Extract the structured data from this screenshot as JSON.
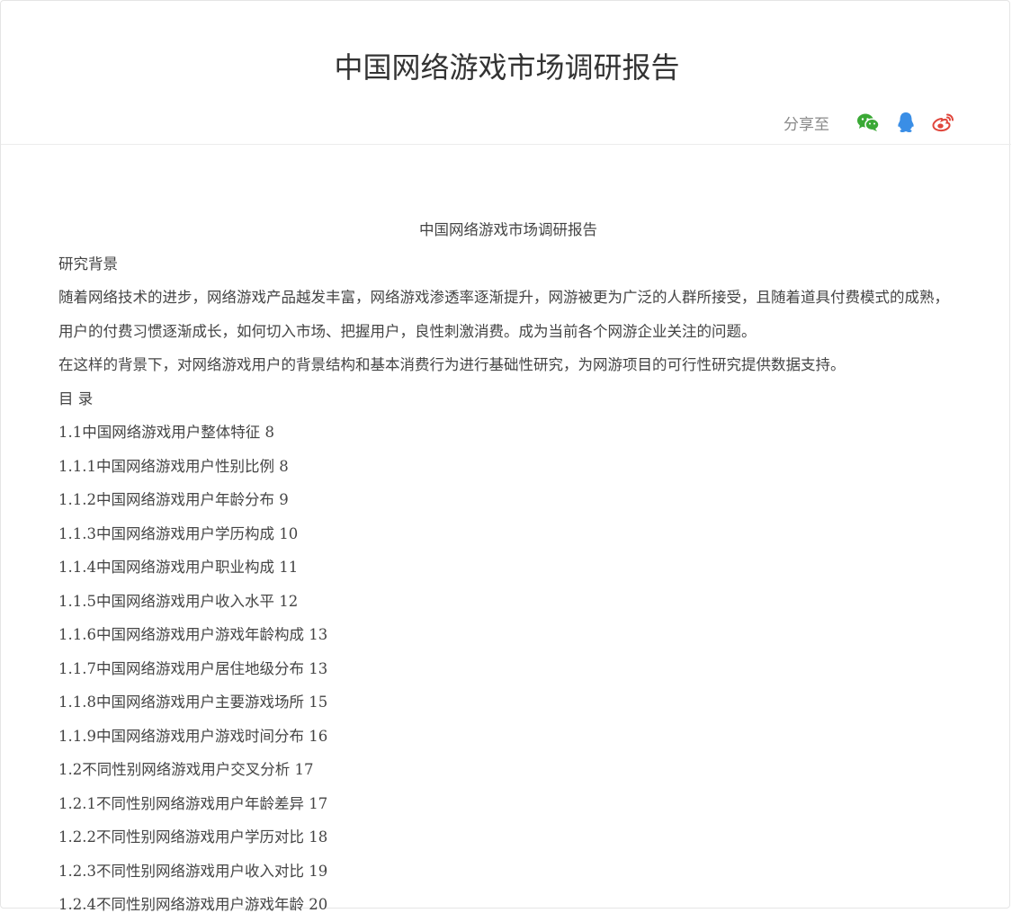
{
  "header": {
    "title": "中国网络游戏市场调研报告",
    "share_label": "分享至",
    "share_icons": [
      "wechat-icon",
      "qq-icon",
      "weibo-icon"
    ],
    "colors": {
      "wechat": "#3aa935",
      "qq": "#3a8ee6",
      "weibo": "#e0463c"
    }
  },
  "article": {
    "doc_title": "中国网络游戏市场调研报告",
    "background_heading": "研究背景",
    "paragraphs": [
      "随着网络技术的进步，网络游戏产品越发丰富，网络游戏渗透率逐渐提升，网游被更为广泛的人群所接受，且随着道具付费模式的成熟，用户的付费习惯逐渐成长，如何切入市场、把握用户，良性刺激消费。成为当前各个网游企业关注的问题。",
      "在这样的背景下，对网络游戏用户的背景结构和基本消费行为进行基础性研究，为网游项目的可行性研究提供数据支持。"
    ],
    "toc_heading": "目 录",
    "toc": [
      {
        "num": "1.1",
        "title": "中国网络游戏用户整体特征",
        "page": "8"
      },
      {
        "num": "1.1.1",
        "title": "中国网络游戏用户性别比例",
        "page": "8"
      },
      {
        "num": "1.1.2",
        "title": "中国网络游戏用户年龄分布",
        "page": "9"
      },
      {
        "num": "1.1.3",
        "title": "中国网络游戏用户学历构成",
        "page": "10"
      },
      {
        "num": "1.1.4",
        "title": "中国网络游戏用户职业构成",
        "page": "11"
      },
      {
        "num": "1.1.5",
        "title": "中国网络游戏用户收入水平",
        "page": "12"
      },
      {
        "num": "1.1.6",
        "title": "中国网络游戏用户游戏年龄构成",
        "page": "13"
      },
      {
        "num": "1.1.7",
        "title": "中国网络游戏用户居住地级分布",
        "page": "13"
      },
      {
        "num": "1.1.8",
        "title": "中国网络游戏用户主要游戏场所",
        "page": "15"
      },
      {
        "num": "1.1.9",
        "title": "中国网络游戏用户游戏时间分布",
        "page": "16"
      },
      {
        "num": "1.2",
        "title": "不同性别网络游戏用户交叉分析",
        "page": "17"
      },
      {
        "num": "1.2.1",
        "title": "不同性别网络游戏用户年龄差异",
        "page": "17"
      },
      {
        "num": "1.2.2",
        "title": "不同性别网络游戏用户学历对比",
        "page": "18"
      },
      {
        "num": "1.2.3",
        "title": "不同性别网络游戏用户收入对比",
        "page": "19"
      },
      {
        "num": "1.2.4",
        "title": "不同性别网络游戏用户游戏年龄",
        "page": "20"
      }
    ]
  }
}
